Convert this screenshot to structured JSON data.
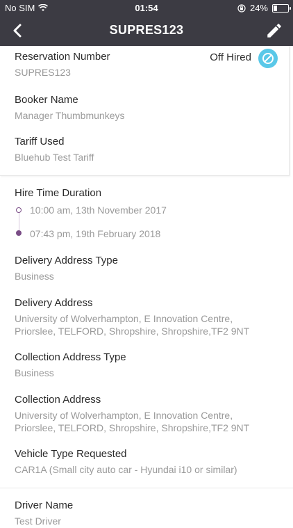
{
  "status_bar": {
    "carrier": "No SIM",
    "time": "01:54",
    "battery": "24%",
    "battery_level_percent": 24,
    "icons": [
      "wifi-icon",
      "orientation-lock-icon",
      "battery-icon"
    ]
  },
  "nav": {
    "title": "SUPRES123",
    "back_icon": "chevron-left-icon",
    "edit_icon": "pencil-icon"
  },
  "reservation": {
    "number_label": "Reservation Number",
    "number_value": "SUPRES123",
    "status_text": "Off Hired",
    "status_icon": "prohibited-icon",
    "booker_label": "Booker  Name",
    "booker_value": "Manager Thumbmunkeys",
    "tariff_label": "Tariff Used",
    "tariff_value": "Bluehub Test Tariff"
  },
  "hire": {
    "label": "Hire Time Duration",
    "start": "10:00 am, 13th November 2017",
    "end": "07:43 pm, 19th February 2018"
  },
  "delivery": {
    "type_label": "Delivery Address Type",
    "type_value": "Business",
    "address_label": "Delivery Address",
    "address_line1": "University of Wolverhampton,  E Innovation Centre,",
    "address_line2": "Priorslee,  TELFORD,  Shropshire,  Shropshire,TF2 9NT"
  },
  "collection": {
    "type_label": "Collection Address Type",
    "type_value": "Business",
    "address_label": "Collection Address",
    "address_line1": "University of Wolverhampton,  E Innovation Centre,",
    "address_line2": "Priorslee,  TELFORD,  Shropshire,  Shropshire,TF2 9NT"
  },
  "vehicle": {
    "label": "Vehicle Type Requested",
    "value": "CAR1A (Small city auto car - Hyundai i10 or similar)"
  },
  "driver": {
    "label": "Driver Name",
    "value": "Test Driver"
  },
  "colors": {
    "header": "#3c3b43",
    "status_icon": "#5ac8e8",
    "timeline": "#7a4d86",
    "label": "#2b2b2b",
    "value": "#9a9a9a"
  }
}
